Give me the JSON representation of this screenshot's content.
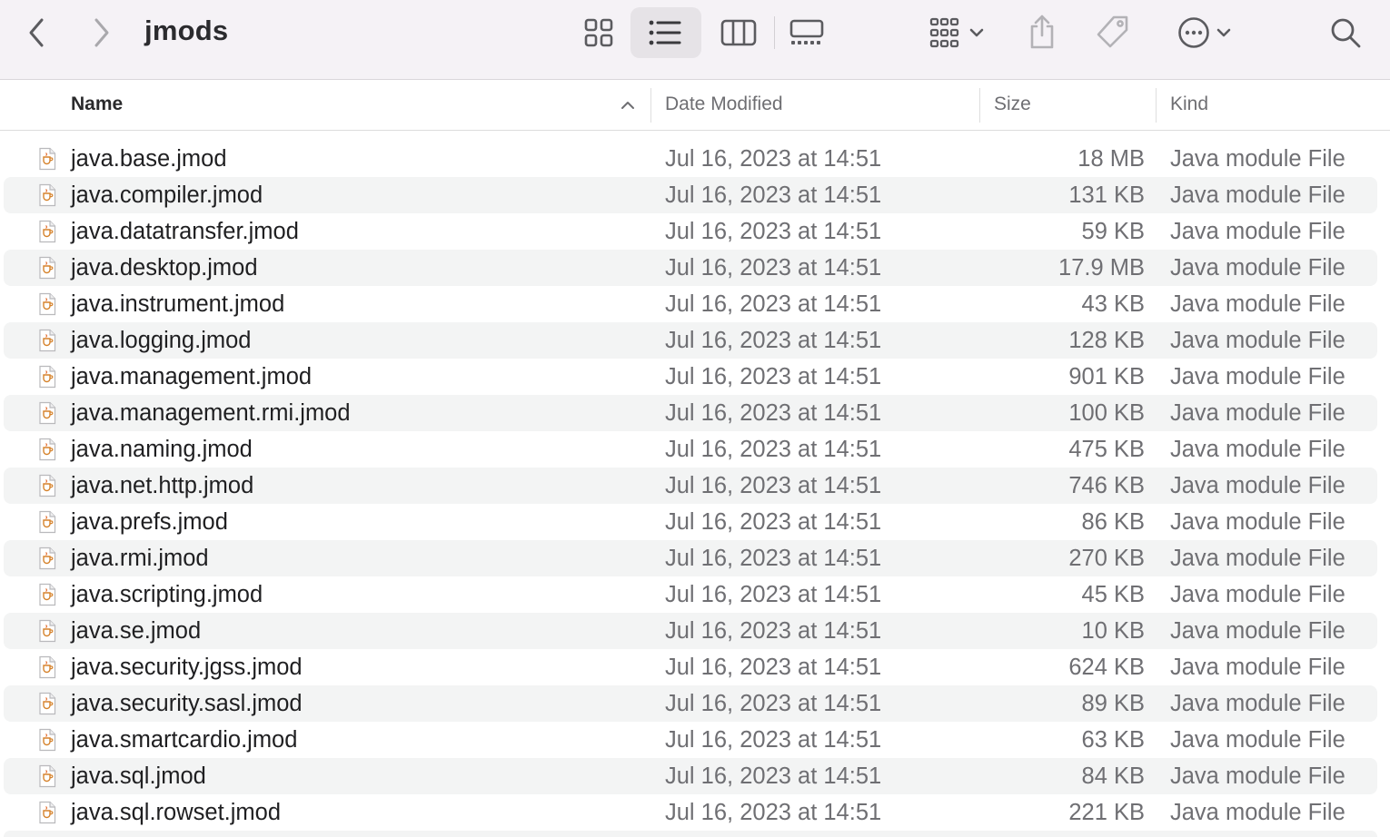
{
  "window": {
    "title": "jmods",
    "toolbar": {
      "back_icon": "chevron-left-icon",
      "forward_icon": "chevron-right-icon",
      "view_icons": "grid-view-icon",
      "view_list": "list-view-icon",
      "view_columns": "column-view-icon",
      "view_gallery": "gallery-view-icon",
      "group_icon": "group-by-icon",
      "share_icon": "share-icon",
      "tag_icon": "tag-icon",
      "more_icon": "ellipsis-circle-icon",
      "search_icon": "search-icon",
      "active_view": "list"
    }
  },
  "columns": {
    "name": "Name",
    "date": "Date Modified",
    "size": "Size",
    "kind": "Kind",
    "sort": "name-ascending"
  },
  "files": [
    {
      "name": "java.base.jmod",
      "date": "Jul 16, 2023 at 14:51",
      "size": "18 MB",
      "kind": "Java module File"
    },
    {
      "name": "java.compiler.jmod",
      "date": "Jul 16, 2023 at 14:51",
      "size": "131 KB",
      "kind": "Java module File"
    },
    {
      "name": "java.datatransfer.jmod",
      "date": "Jul 16, 2023 at 14:51",
      "size": "59 KB",
      "kind": "Java module File"
    },
    {
      "name": "java.desktop.jmod",
      "date": "Jul 16, 2023 at 14:51",
      "size": "17.9 MB",
      "kind": "Java module File"
    },
    {
      "name": "java.instrument.jmod",
      "date": "Jul 16, 2023 at 14:51",
      "size": "43 KB",
      "kind": "Java module File"
    },
    {
      "name": "java.logging.jmod",
      "date": "Jul 16, 2023 at 14:51",
      "size": "128 KB",
      "kind": "Java module File"
    },
    {
      "name": "java.management.jmod",
      "date": "Jul 16, 2023 at 14:51",
      "size": "901 KB",
      "kind": "Java module File"
    },
    {
      "name": "java.management.rmi.jmod",
      "date": "Jul 16, 2023 at 14:51",
      "size": "100 KB",
      "kind": "Java module File"
    },
    {
      "name": "java.naming.jmod",
      "date": "Jul 16, 2023 at 14:51",
      "size": "475 KB",
      "kind": "Java module File"
    },
    {
      "name": "java.net.http.jmod",
      "date": "Jul 16, 2023 at 14:51",
      "size": "746 KB",
      "kind": "Java module File"
    },
    {
      "name": "java.prefs.jmod",
      "date": "Jul 16, 2023 at 14:51",
      "size": "86 KB",
      "kind": "Java module File"
    },
    {
      "name": "java.rmi.jmod",
      "date": "Jul 16, 2023 at 14:51",
      "size": "270 KB",
      "kind": "Java module File"
    },
    {
      "name": "java.scripting.jmod",
      "date": "Jul 16, 2023 at 14:51",
      "size": "45 KB",
      "kind": "Java module File"
    },
    {
      "name": "java.se.jmod",
      "date": "Jul 16, 2023 at 14:51",
      "size": "10 KB",
      "kind": "Java module File"
    },
    {
      "name": "java.security.jgss.jmod",
      "date": "Jul 16, 2023 at 14:51",
      "size": "624 KB",
      "kind": "Java module File"
    },
    {
      "name": "java.security.sasl.jmod",
      "date": "Jul 16, 2023 at 14:51",
      "size": "89 KB",
      "kind": "Java module File"
    },
    {
      "name": "java.smartcardio.jmod",
      "date": "Jul 16, 2023 at 14:51",
      "size": "63 KB",
      "kind": "Java module File"
    },
    {
      "name": "java.sql.jmod",
      "date": "Jul 16, 2023 at 14:51",
      "size": "84 KB",
      "kind": "Java module File"
    },
    {
      "name": "java.sql.rowset.jmod",
      "date": "Jul 16, 2023 at 14:51",
      "size": "221 KB",
      "kind": "Java module File"
    }
  ]
}
